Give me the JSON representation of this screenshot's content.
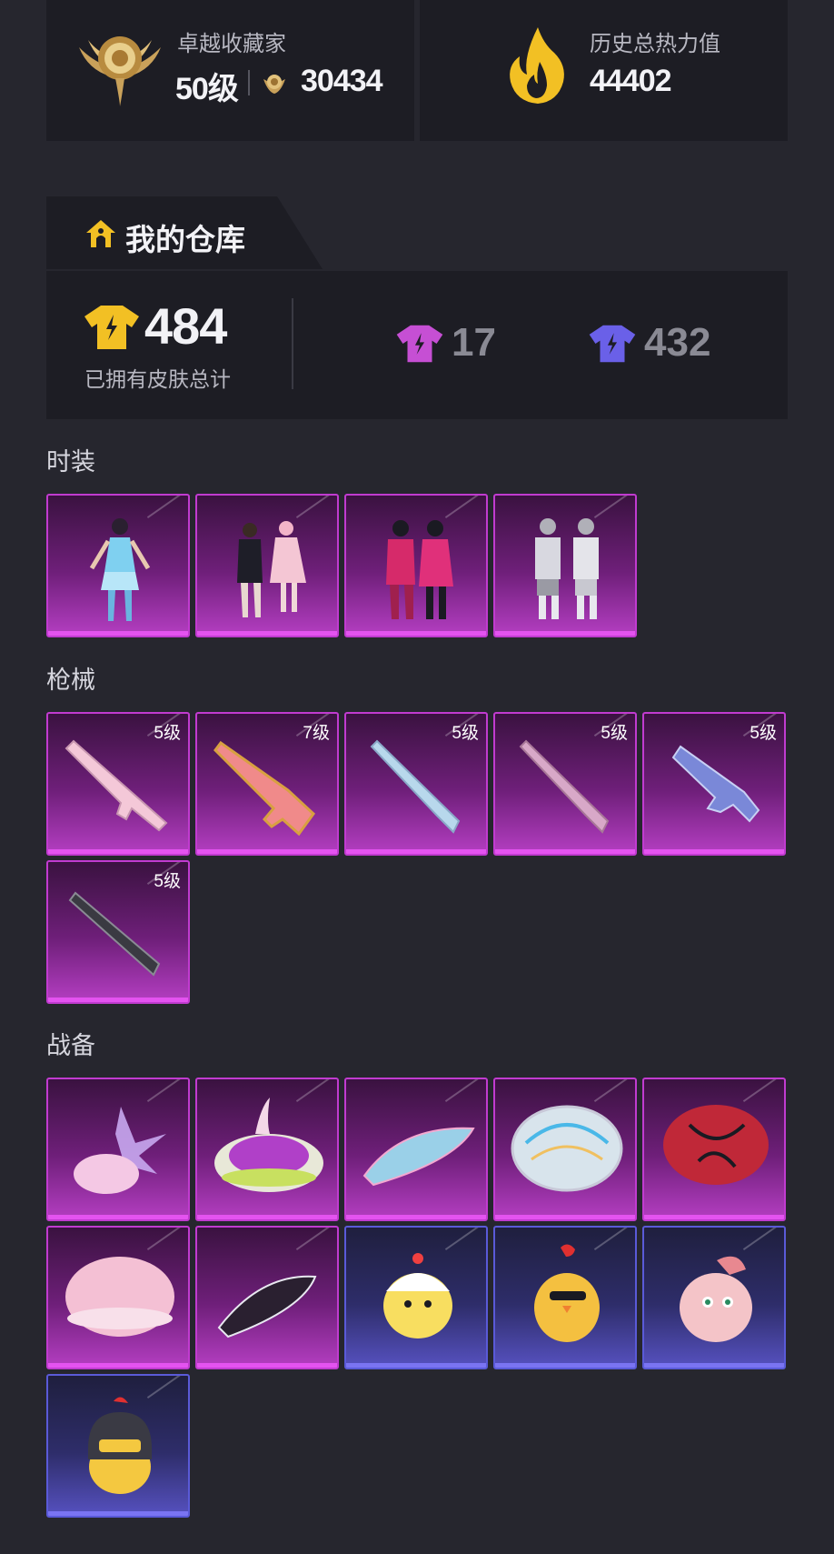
{
  "profile": {
    "rank_title": "卓越收藏家",
    "level": "50级",
    "points": "30434",
    "heat_label": "历史总热力值",
    "heat_value": "44402"
  },
  "warehouse": {
    "title": "我的仓库",
    "total_count": "484",
    "total_label": "已拥有皮肤总计",
    "purple_count": "17",
    "blue_count": "432"
  },
  "sections": {
    "fashion": "时装",
    "guns": "枪械",
    "gear": "战备"
  },
  "guns": [
    {
      "level": "5级"
    },
    {
      "level": "7级"
    },
    {
      "level": "5级"
    },
    {
      "level": "5级"
    },
    {
      "level": "5级"
    },
    {
      "level": "5级"
    }
  ],
  "colors": {
    "background": "#26262e",
    "panel": "#1d1d24",
    "purple_tile": "#b43ec2",
    "blue_tile": "#5651c0",
    "gold": "#f2c024"
  },
  "icons": [
    "medal-icon",
    "flame-icon",
    "house-icon",
    "shirt-gold-icon",
    "shirt-purple-icon",
    "shirt-blue-icon",
    "coin-icon"
  ]
}
